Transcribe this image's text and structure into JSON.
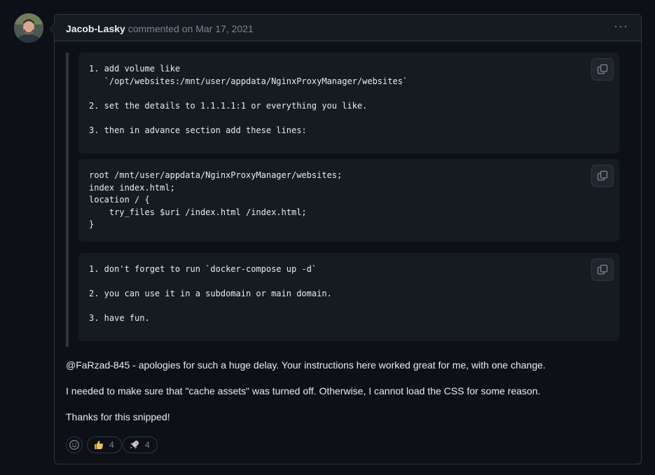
{
  "comment": {
    "author": "Jacob-Lasky",
    "action": "commented on",
    "date": "Mar 17, 2021",
    "menu_label": "···"
  },
  "code_blocks": [
    {
      "lines": "1. add volume like\n   `/opt/websites:/mnt/user/appdata/NginxProxyManager/websites`\n\n2. set the details to 1.1.1.1:1 or everything you like.\n\n3. then in advance section add these lines:"
    },
    {
      "lines": "root /mnt/user/appdata/NginxProxyManager/websites;\nindex index.html;\nlocation / {\n    try_files $uri /index.html /index.html;\n}"
    },
    {
      "lines": "1. don't forget to run `docker-compose up -d`\n\n2. you can use it in a subdomain or main domain.\n\n3. have fun."
    }
  ],
  "body": {
    "mention": "@FaRzad-845",
    "para1_rest": " - apologies for such a huge delay. Your instructions here worked great for me, with one change.",
    "para2": "I needed to make sure that \"cache assets\" was turned off. Otherwise, I cannot load the CSS for some reason.",
    "para3": "Thanks for this snipped!"
  },
  "reactions": [
    {
      "icon": "thumbs-up-icon",
      "count": "4"
    },
    {
      "icon": "rocket-icon",
      "count": "4"
    }
  ]
}
